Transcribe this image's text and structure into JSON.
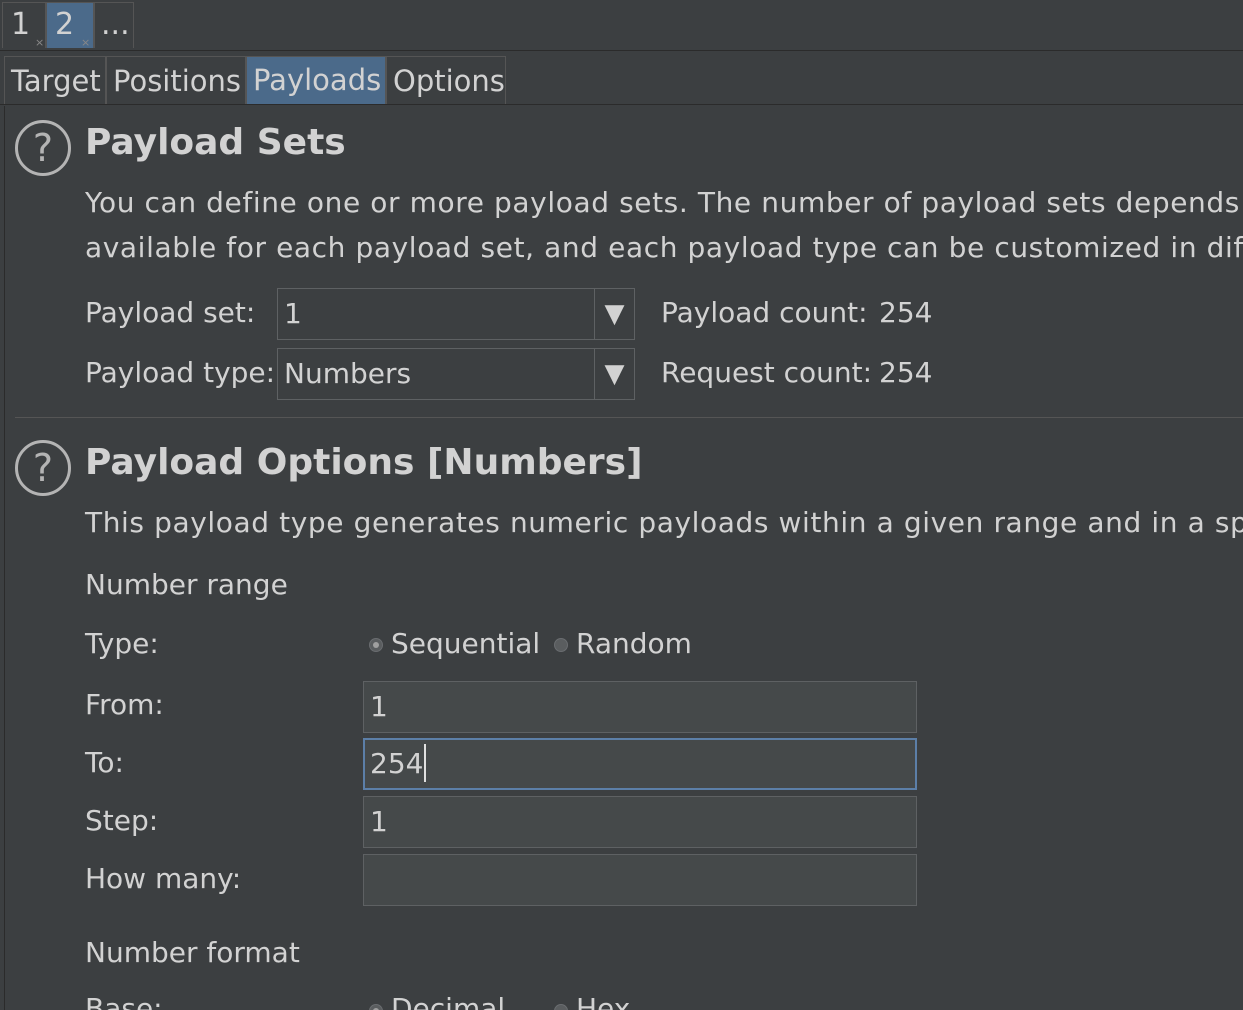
{
  "instance_tabs": [
    {
      "label": "1",
      "close": "×"
    },
    {
      "label": "2",
      "close": "×"
    },
    {
      "label": "..."
    }
  ],
  "sub_tabs": [
    "Target",
    "Positions",
    "Payloads",
    "Options"
  ],
  "payload_sets": {
    "title": "Payload Sets",
    "description_line1": "You can define one or more payload sets. The number of payload sets depends on",
    "description_line2": "available for each payload set, and each payload type can be customized in differen",
    "payload_set_label": "Payload set:",
    "payload_set_value": "1",
    "payload_type_label": "Payload type:",
    "payload_type_value": "Numbers",
    "payload_count_label": "Payload count:",
    "payload_count_value": "254",
    "request_count_label": "Request count:",
    "request_count_value": "254",
    "dropdown_arrow": "▼"
  },
  "payload_options": {
    "title": "Payload Options [Numbers]",
    "description": "This payload type generates numeric payloads within a given range and in a specifie",
    "number_range_label": "Number range",
    "type_label": "Type:",
    "type_options": [
      "Sequential",
      "Random"
    ],
    "type_selected": "Sequential",
    "from_label": "From:",
    "from_value": "1",
    "to_label": "To:",
    "to_value": "254",
    "step_label": "Step:",
    "step_value": "1",
    "how_many_label": "How many:",
    "how_many_value": "",
    "number_format_label": "Number format",
    "base_label": "Base:",
    "base_options": [
      "Decimal",
      "Hex"
    ],
    "base_selected": "Decimal"
  },
  "help_icon_glyph": "?"
}
